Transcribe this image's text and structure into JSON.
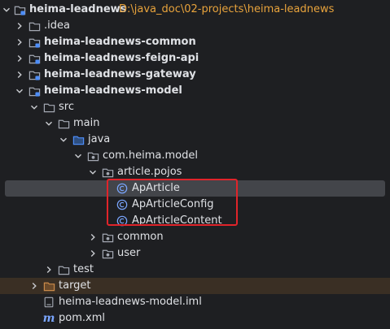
{
  "root": {
    "name": "heima-leadnews",
    "path": "D:\\java_doc\\02-projects\\heima-leadnews"
  },
  "items": [
    {
      "label": ".idea"
    },
    {
      "label": "heima-leadnews-common"
    },
    {
      "label": "heima-leadnews-feign-api"
    },
    {
      "label": "heima-leadnews-gateway"
    },
    {
      "label": "heima-leadnews-model"
    },
    {
      "label": "src"
    },
    {
      "label": "main"
    },
    {
      "label": "java"
    },
    {
      "label": "com.heima.model"
    },
    {
      "label": "article.pojos"
    },
    {
      "label": "ApArticle"
    },
    {
      "label": "ApArticleConfig"
    },
    {
      "label": "ApArticleContent"
    },
    {
      "label": "common"
    },
    {
      "label": "user"
    },
    {
      "label": "test"
    },
    {
      "label": "target"
    },
    {
      "label": "heima-leadnews-model.iml"
    },
    {
      "label": "pom.xml"
    }
  ],
  "colors": {
    "background": "#1e1f22",
    "selected_row": "#43454a",
    "excluded_row": "#3a2f24",
    "folder": "#a3a8b2",
    "module_blue": "#4d8df7",
    "class_icon": "#7aa6ff",
    "path_text": "#e8a33c",
    "highlight_box": "#e0242a"
  }
}
